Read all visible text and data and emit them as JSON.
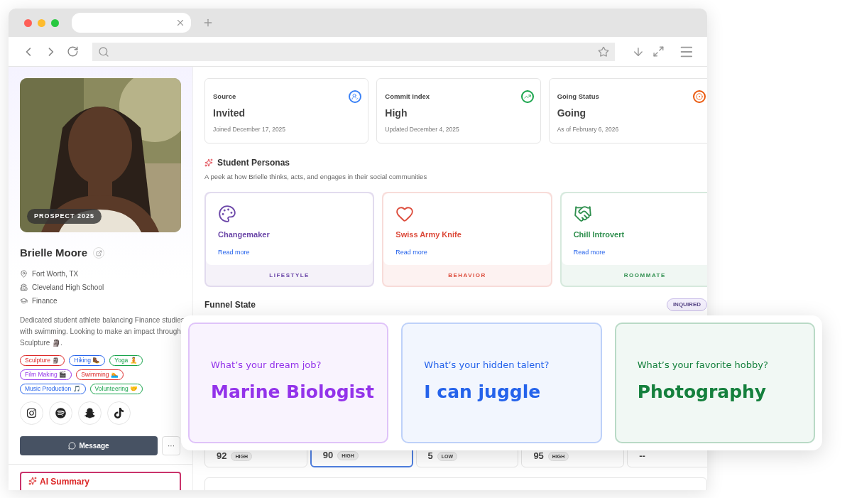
{
  "profile": {
    "photo_badge": "PROSPECT 2025",
    "name": "Brielle Moore",
    "details": [
      {
        "kind": "location",
        "text": "Fort Worth, TX"
      },
      {
        "kind": "school",
        "text": "Cleveland High School"
      },
      {
        "kind": "major",
        "text": "Finance"
      }
    ],
    "bio": "Dedicated student athlete balancing Finance studies with swimming. Looking to make an impact through Sculpture 🗿.",
    "tags": [
      {
        "label": "Sculpture 🗿",
        "color": "#dc2626"
      },
      {
        "label": "Hiking 🥾",
        "color": "#2563eb"
      },
      {
        "label": "Yoga 🧘",
        "color": "#16a34a"
      },
      {
        "label": "Film Making 🎬",
        "color": "#9333ea"
      },
      {
        "label": "Swimming 🏊",
        "color": "#dc2626"
      },
      {
        "label": "Music Production 🎵",
        "color": "#2563eb"
      },
      {
        "label": "Volunteering 🤝",
        "color": "#16a34a"
      }
    ],
    "socials": [
      {
        "kind": "instagram"
      },
      {
        "kind": "spotify"
      },
      {
        "kind": "snapchat"
      },
      {
        "kind": "tiktok"
      }
    ],
    "message_button": "Message",
    "more_button": "···",
    "ai_summary": "AI Summary"
  },
  "stats": [
    {
      "kind": "source",
      "label": "Source",
      "value": "Invited",
      "note": "Joined December 17, 2025",
      "color": "#3b82f6"
    },
    {
      "kind": "commit",
      "label": "Commit Index",
      "value": "High",
      "note": "Updated December 4, 2025",
      "color": "#16a34a"
    },
    {
      "kind": "status",
      "label": "Going Status",
      "value": "Going",
      "note": "As of February 6, 2026",
      "color": "#ea580c"
    }
  ],
  "personas": {
    "title": "Student Personas",
    "subtitle": "A peek at how Brielle thinks, acts, and engages in their social communities",
    "cards": [
      {
        "kind": "palette",
        "name": "Changemaker",
        "link": "Read more",
        "category": "LIFESTYLE",
        "color": "#6b46a8"
      },
      {
        "kind": "heart",
        "name": "Swiss Army Knife",
        "link": "Read more",
        "category": "BEHAVIOR",
        "color": "#dc4a3a"
      },
      {
        "kind": "handshake",
        "name": "Chill Introvert",
        "link": "Read more",
        "category": "ROOMMATE",
        "color": "#2f8f4e"
      }
    ]
  },
  "funnel": {
    "title": "Funnel State",
    "badge": "INQUIRED",
    "cells": [
      {
        "value": "92",
        "badge": "HIGH",
        "selected": false
      },
      {
        "value": "90",
        "badge": "HIGH",
        "selected": true
      },
      {
        "value": "5",
        "badge": "LOW",
        "selected": false
      },
      {
        "value": "95",
        "badge": "HIGH",
        "selected": false
      },
      {
        "value": "--",
        "selected": false
      }
    ]
  },
  "highlights": [
    {
      "question": "What’s your dream job?",
      "answer": "Marine Biologist",
      "color": "#9333ea"
    },
    {
      "question": "What’s your hidden talent?",
      "answer": "I can juggle",
      "color": "#2563eb"
    },
    {
      "question": "What’s your favorite hobby?",
      "answer": "Photography",
      "color": "#15803d"
    }
  ]
}
